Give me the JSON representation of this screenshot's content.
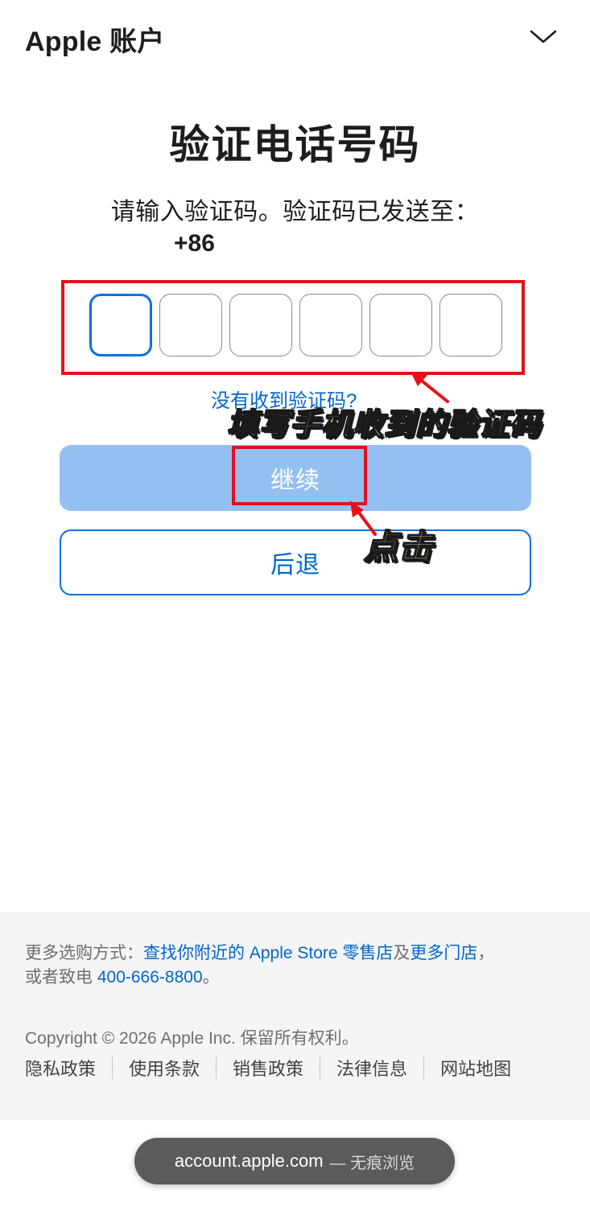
{
  "header": {
    "brand": "Apple 账户"
  },
  "verify": {
    "title": "验证电话号码",
    "prompt": "请输入验证码。验证码已发送至：",
    "phone": "+86",
    "resend_link": "没有收到验证码?"
  },
  "buttons": {
    "continue_label": "继续",
    "back_label": "后退"
  },
  "annotations": {
    "hint_code": "填写手机收到的验证码",
    "hint_click": "点击",
    "color": "#e8101a"
  },
  "footer": {
    "more_prefix": "更多选购方式：",
    "find_store_link": "查找你附近的 Apple Store 零售店",
    "and": "及",
    "more_stores_link": "更多门店",
    "comma": "，",
    "call_prefix": "或者致电 ",
    "phone_link": "400-666-8800",
    "period": "。",
    "copyright": "Copyright © 2026 Apple Inc. 保留所有权利。",
    "links": [
      "隐私政策",
      "使用条款",
      "销售政策",
      "法律信息",
      "网站地图"
    ]
  },
  "browser": {
    "url": "account.apple.com",
    "mode": "— 无痕浏览"
  },
  "colors": {
    "accent": "#0071e3",
    "link": "#0066cc",
    "continue_disabled": "#94c0f1",
    "footer_bg": "#f5f5f7"
  }
}
